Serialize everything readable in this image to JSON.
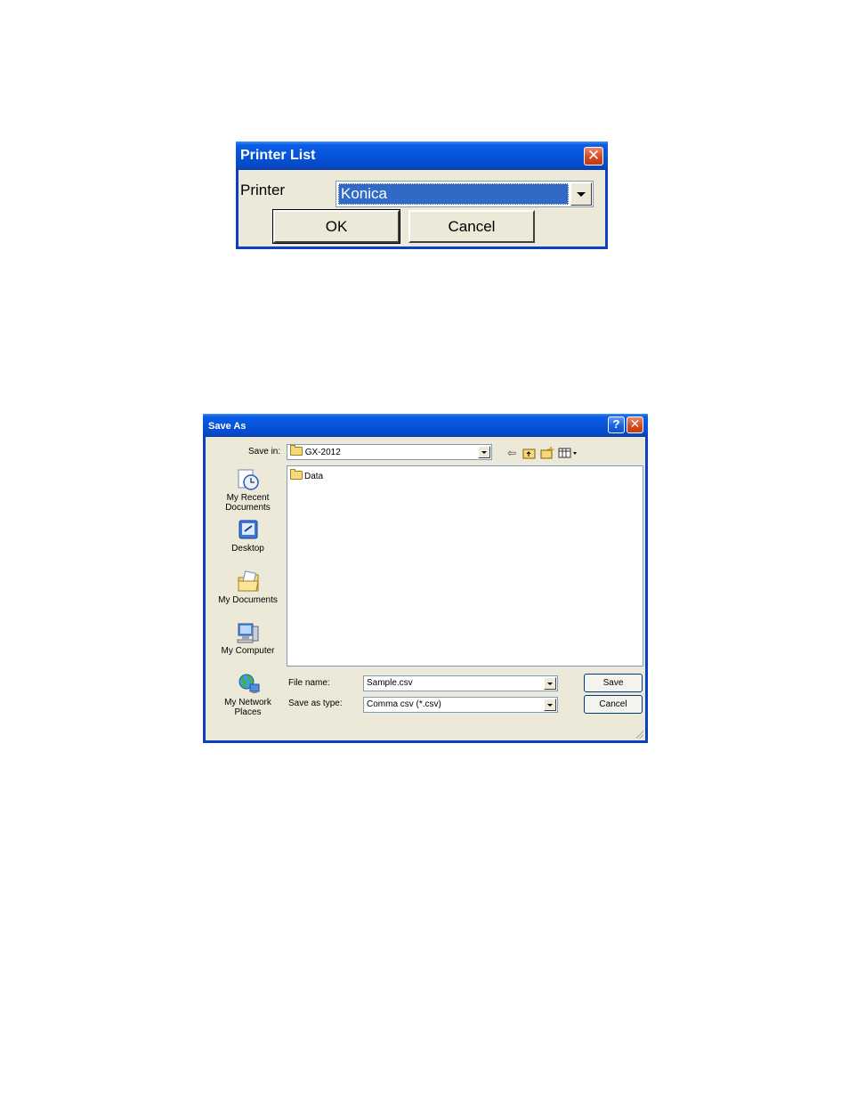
{
  "printer_list": {
    "title": "Printer List",
    "close_icon": "close-icon",
    "printer_label": "Printer",
    "printer_value": "Konica",
    "ok_label": "OK",
    "cancel_label": "Cancel"
  },
  "save_as": {
    "title": "Save As",
    "help_icon": "help-icon",
    "close_icon": "close-icon",
    "save_in_label": "Save in:",
    "save_in_value": "GX-2012",
    "toolbar": [
      "back-icon",
      "up-folder-icon",
      "new-folder-icon",
      "view-menu-icon"
    ],
    "places": [
      {
        "label": "My Recent Documents",
        "icon": "recent-documents-icon"
      },
      {
        "label": "Desktop",
        "icon": "desktop-icon"
      },
      {
        "label": "My Documents",
        "icon": "my-documents-icon"
      },
      {
        "label": "My Computer",
        "icon": "my-computer-icon"
      },
      {
        "label": "My Network Places",
        "icon": "network-places-icon"
      }
    ],
    "files": [
      {
        "name": "Data",
        "type": "folder"
      }
    ],
    "file_name_label": "File name:",
    "file_name_value": "Sample.csv",
    "save_type_label": "Save as type:",
    "save_type_value": "Comma csv (*.csv)",
    "save_label": "Save",
    "cancel_label": "Cancel"
  },
  "colors": {
    "title_blue": "#0653d9",
    "dialog_face": "#ece9d8",
    "selection_blue": "#3169c6",
    "close_red": "#d64a22"
  }
}
